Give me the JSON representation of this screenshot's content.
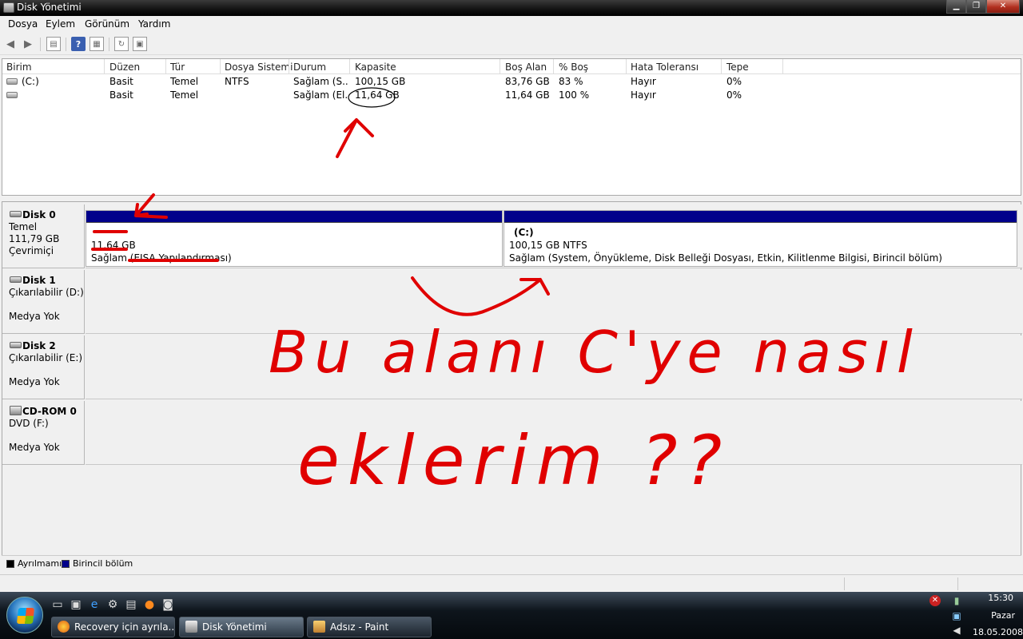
{
  "window": {
    "title": "Disk Yönetimi",
    "minimize": "▁",
    "maximize": "❐",
    "close": "✕"
  },
  "menu": [
    "Dosya",
    "Eylem",
    "Görünüm",
    "Yardım"
  ],
  "volume_table": {
    "columns": [
      "Birim",
      "Düzen",
      "Tür",
      "Dosya Sistemi",
      "Durum",
      "Kapasite",
      "Boş Alan",
      "% Boş",
      "Hata Toleransı",
      "Tepe"
    ],
    "rows": [
      [
        "(C:)",
        "Basit",
        "Temel",
        "NTFS",
        "Sağlam (S...",
        "100,15 GB",
        "83,76 GB",
        "83 %",
        "Hayır",
        "0%"
      ],
      [
        "",
        "Basit",
        "Temel",
        "",
        "Sağlam (El...",
        "11,64 GB",
        "11,64 GB",
        "100 %",
        "Hayır",
        "0%"
      ]
    ]
  },
  "disks": [
    {
      "name": "Disk 0",
      "line1": "Temel",
      "line2": "111,79 GB",
      "line3": "Çevrimiçi",
      "partitions": [
        {
          "label": "",
          "size": "11,64 GB",
          "status": "Sağlam (EISA Yapılandırması)"
        },
        {
          "label": "(C:)",
          "size": "100,15 GB NTFS",
          "status": "Sağlam (System, Önyükleme, Disk Belleği Dosyası, Etkin, Kilitlenme Bilgisi, Birincil bölüm)"
        }
      ]
    },
    {
      "name": "Disk 1",
      "line1": "Çıkarılabilir (D:)",
      "line2": "",
      "line3": "Medya Yok"
    },
    {
      "name": "Disk 2",
      "line1": "Çıkarılabilir (E:)",
      "line2": "",
      "line3": "Medya Yok"
    },
    {
      "name": "CD-ROM 0",
      "line1": "DVD (F:)",
      "line2": "",
      "line3": "Medya Yok"
    }
  ],
  "legend": [
    {
      "label": "Ayrılmamış",
      "color": "#000000"
    },
    {
      "label": "Birincil bölüm",
      "color": "#00008b"
    }
  ],
  "handwriting": {
    "line1": "Bu alanı C'ye nasıl",
    "line2": "eklerim ??",
    "color": "#e00000"
  },
  "taskbar": {
    "buttons": [
      "Recovery için ayrıla...",
      "Disk Yönetimi",
      "Adsız - Paint"
    ],
    "clock": {
      "time": "15:30",
      "day": "Pazar",
      "date": "18.05.2008"
    }
  },
  "colors": {
    "primary_partition": "#00008b",
    "taskbar": "#0e151c",
    "annotation": "#e00000"
  }
}
